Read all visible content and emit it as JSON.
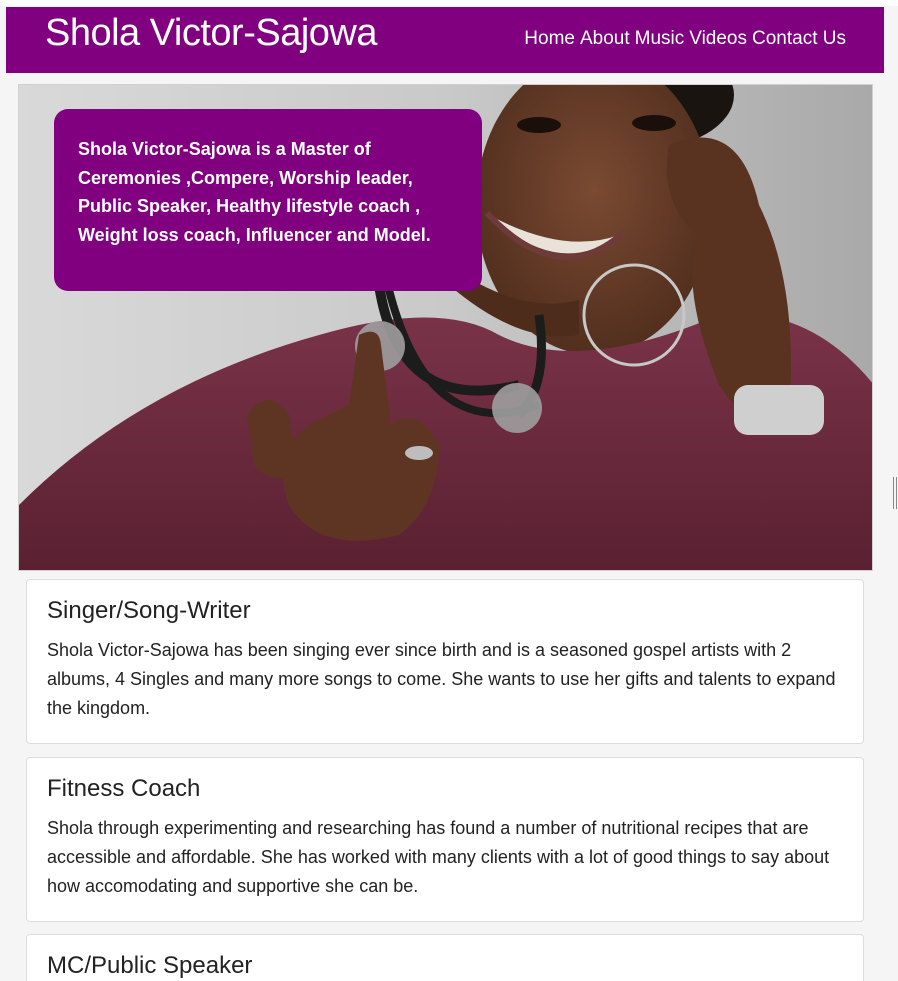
{
  "site": {
    "brand": "Shola Victor-Sajowa"
  },
  "nav": {
    "items": [
      {
        "label": "Home"
      },
      {
        "label": "About"
      },
      {
        "label": "Music"
      },
      {
        "label": "Videos"
      },
      {
        "label": "Contact Us"
      }
    ]
  },
  "hero": {
    "intro": "Shola Victor-Sajowa is a Master of Ceremonies ,Compere, Worship leader, Public Speaker, Healthy lifestyle coach , Weight loss coach, Influencer and Model."
  },
  "sections": [
    {
      "title": "Singer/Song-Writer",
      "body": "Shola Victor-Sajowa has been singing ever since birth and is a seasoned gospel artists with 2 albums, 4 Singles and many more songs to come. She wants to use her gifts and talents to expand the kingdom."
    },
    {
      "title": "Fitness Coach",
      "body": "Shola through experimenting and researching has found a number of nutritional recipes that are accessible and affordable. She has worked with many clients with a lot of good things to say about how accomodating and supportive she can be."
    },
    {
      "title": "MC/Public Speaker",
      "body": ""
    }
  ],
  "colors": {
    "brand_purple": "#800080",
    "sweater": "#6b2a3e"
  }
}
